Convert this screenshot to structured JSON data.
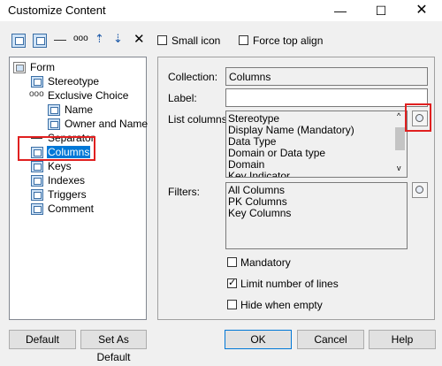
{
  "window": {
    "title": "Customize Content"
  },
  "toolbar": {
    "small_icon_label": "Small icon",
    "force_top_align_label": "Force top align",
    "small_icon_checked": false,
    "force_top_align_checked": false,
    "icons": [
      "add-form-icon",
      "add-list-icon",
      "add-separator-icon",
      "add-exclusive-choice-icon",
      "move-up-icon",
      "move-down-icon",
      "delete-icon"
    ]
  },
  "tree": {
    "items": [
      {
        "label": "Form",
        "icon": "form-icon"
      },
      {
        "label": "Stereotype",
        "icon": "attribute-icon"
      },
      {
        "label": "Exclusive Choice",
        "icon": "exclusive-choice-icon"
      },
      {
        "label": "Name",
        "icon": "attribute-icon"
      },
      {
        "label": "Owner and Name",
        "icon": "attribute-icon"
      },
      {
        "label": "Separator",
        "icon": "separator-icon"
      },
      {
        "label": "Columns",
        "icon": "list-icon",
        "selected": true
      },
      {
        "label": "Keys",
        "icon": "list-icon"
      },
      {
        "label": "Indexes",
        "icon": "list-icon"
      },
      {
        "label": "Triggers",
        "icon": "list-icon"
      },
      {
        "label": "Comment",
        "icon": "attribute-icon"
      }
    ]
  },
  "properties": {
    "collection_label": "Collection:",
    "collection_value": "Columns",
    "label_label": "Label:",
    "label_value": "",
    "list_columns_label": "List columns:",
    "list_columns": [
      "Stereotype",
      "Display Name (Mandatory)",
      "Data Type",
      "Domain or Data type",
      "Domain",
      "Key Indicator"
    ],
    "filters_label": "Filters:",
    "filters": [
      "All Columns",
      "PK Columns",
      "Key Columns"
    ],
    "mandatory_label": "Mandatory",
    "mandatory_checked": false,
    "limit_lines_label": "Limit number of lines",
    "limit_lines_checked": true,
    "hide_empty_label": "Hide when empty",
    "hide_empty_checked": false
  },
  "buttons": {
    "default": "Default",
    "set_as_default": "Set As Default",
    "ok": "OK",
    "cancel": "Cancel",
    "help": "Help"
  },
  "colors": {
    "selection": "#0078d7",
    "highlight_box": "#e02020"
  }
}
